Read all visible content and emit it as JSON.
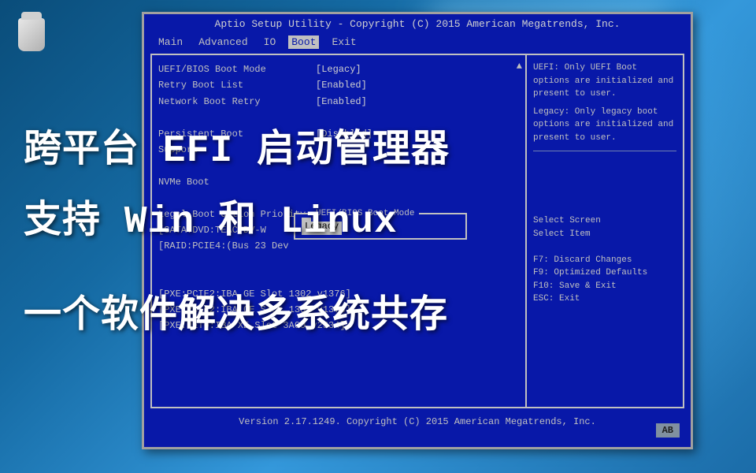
{
  "bios": {
    "title": "Aptio Setup Utility - Copyright (C) 2015 American Megatrends, Inc.",
    "tabs": [
      "Main",
      "Advanced",
      "IO",
      "Boot",
      "Exit"
    ],
    "active_tab": "Boot",
    "settings": [
      {
        "label": "UEFI/BIOS Boot Mode",
        "value": "[Legacy]"
      },
      {
        "label": "Retry Boot List",
        "value": "[Enabled]"
      },
      {
        "label": "Network Boot Retry",
        "value": "[Enabled]"
      },
      {
        "label": "",
        "value": ""
      },
      {
        "label": "Persistent Boot",
        "value": "[Disabled]"
      },
      {
        "label": "Support",
        "value": ""
      },
      {
        "label": "",
        "value": ""
      },
      {
        "label": "NVMe Boot",
        "value": ""
      },
      {
        "label": "",
        "value": ""
      },
      {
        "label": "Legal Boot Option Priority",
        "value": ""
      }
    ],
    "boot_list": [
      "[SATA:DVD:TEAC  DV-W",
      "[RAID:PCIE4:(Bus 23 Dev",
      "[PXE:PCIE2:IBA GE Slot 1302 v1376]",
      "[PXE:PCIE2:IBA GE Slot 1303 v1376]",
      "[PXE:NET0:IBA XE Slot 3A00 v2334]"
    ],
    "help": {
      "description": "UEFI: Only UEFI Boot options are initialized and present to user.",
      "description2": "Legacy: Only legacy boot options are initialized and present to user.",
      "keys": [
        "Select Screen",
        "Select Item",
        "",
        "F7: Discard Changes",
        "F9: Optimized Defaults",
        "F10: Save & Exit",
        "ESC: Exit"
      ]
    },
    "popup": {
      "title": "UEFI/BIOS Boot Mode",
      "option": "Legacy"
    },
    "footer": "Version 2.17.1249. Copyright (C) 2015 American Megatrends, Inc.",
    "badge": "AB"
  },
  "overlay": {
    "line1": "跨平台 EFI 启动管理器",
    "line2": "支持 Win 和 Linux",
    "line3": "一个软件解决多系统共存"
  }
}
